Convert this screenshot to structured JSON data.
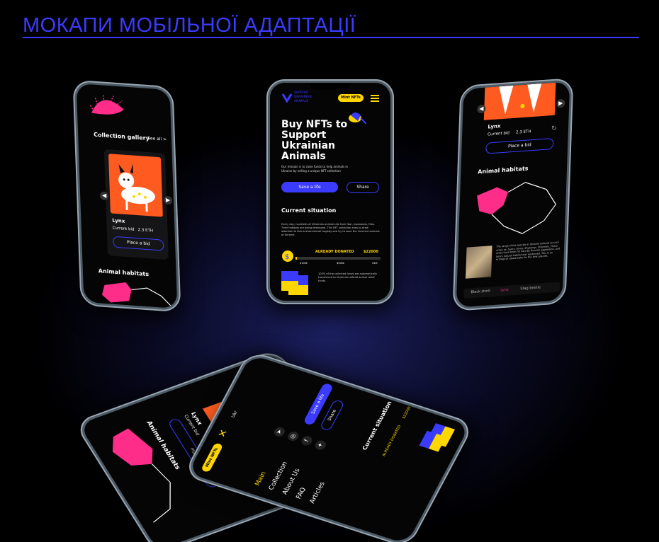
{
  "page": {
    "title": "МОКАПИ МОБІЛЬНОЇ АДАПТАЦІЇ"
  },
  "brand": {
    "line1": "SUPPORT",
    "line2": "UKRAINIAN",
    "line3": "ANIMALS"
  },
  "colors": {
    "accent": "#3b3bff",
    "yellow": "#ffd600",
    "pink": "#ff2d8a",
    "background": "#000000"
  },
  "phone_left": {
    "section_title": "Collection gallery",
    "see_all": "See all >",
    "card": {
      "name": "Lynx",
      "bid_label": "Current bid",
      "bid_value": "2.3 ETH",
      "button": "Place a bid"
    },
    "habitats_title": "Animal habitats"
  },
  "phone_center": {
    "mint_button": "Mint NFTs",
    "hero_title": "Buy NFTs to Support Ukrainian Animals",
    "hero_text": "Our mission is to raise funds to help animals in Ukraine by selling a unique NFT collection",
    "primary_button": "Save a life",
    "secondary_button": "Share",
    "situation_title": "Current situation",
    "situation_text": "Every day, hundreds of Ukrainian animals die from fear, explosions, fires. Their habitats are being destroyed. This NFT collection aims to draw attention to this environmental tragedy and try to save the innocent animals of Ukraine.",
    "donated_label": "ALREADY DONATED",
    "donated_value": "$22000",
    "scale_marks": [
      "$100k",
      "$500k",
      "$1M"
    ],
    "bottom_text": "100% of the collected funds are automatically transferred to Ukrainian official animal relief funds."
  },
  "phone_right": {
    "card": {
      "name": "Lynx",
      "bid_label": "Current bid",
      "bid_value": "2.3 ETH",
      "button": "Place a bid"
    },
    "habitats_title": "Animal habitats",
    "species_text": "The range of the species in Ukraine extends to such areas as: Sumy, Rivne, Zhytomyr, Chernihiv. These areas have been hit hard by Russian aggression, and lynx's natural habitat was destroyed. This is an ecological catastrophe for the lynx species.",
    "tabs": [
      "Black stork",
      "Lynx",
      "Stag beetle"
    ]
  },
  "phone_bottom_back": {
    "title_partial": "Co",
    "name": "Lynx",
    "bid": "Current bid",
    "button": "Place",
    "habitats_title": "Animal habitats"
  },
  "phone_bottom_front": {
    "menu": [
      "Main",
      "Collection",
      "About Us",
      "FAQ",
      "Articles"
    ],
    "mint_button": "Mint NFTs",
    "lang": "Ukr",
    "primary_button": "Save a life",
    "secondary_button": "Share",
    "situation_title": "Current situation",
    "donated_label": "ALREADY DONATED",
    "donated_value": "$22000"
  }
}
